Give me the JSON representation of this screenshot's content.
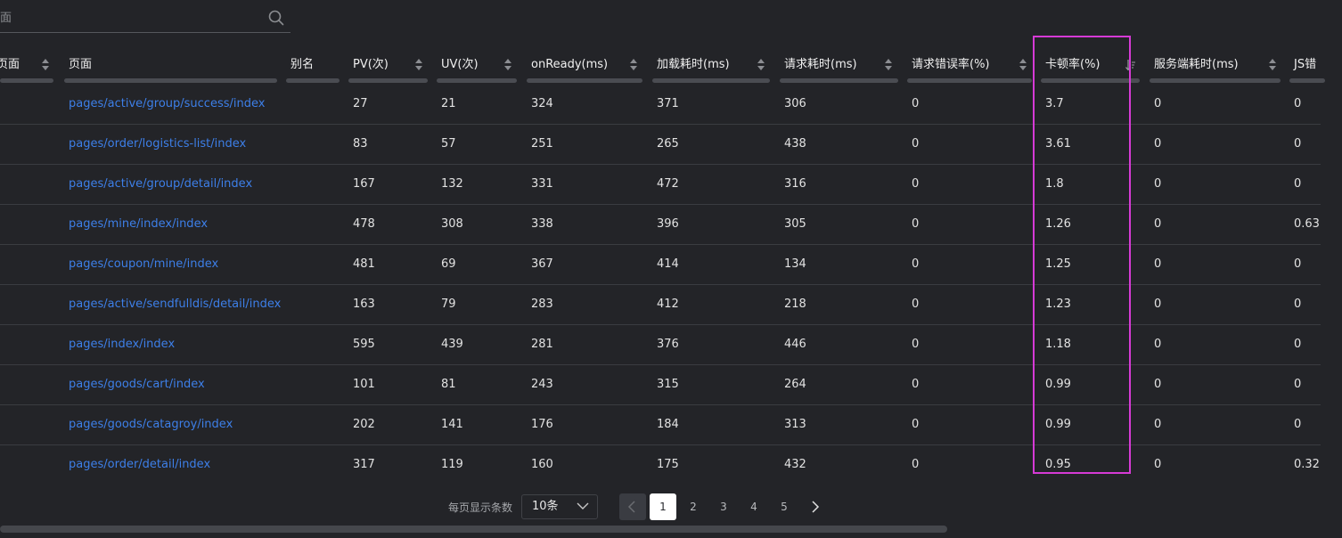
{
  "search": {
    "placeholder": "面",
    "icon": "search-icon"
  },
  "table": {
    "headers": [
      {
        "label": "页面"
      },
      {
        "label": "页面"
      },
      {
        "label": "别名"
      },
      {
        "label": "PV(次)"
      },
      {
        "label": "UV(次)"
      },
      {
        "label": "onReady(ms)"
      },
      {
        "label": "加载耗时(ms)"
      },
      {
        "label": "请求耗时(ms)"
      },
      {
        "label": "请求错误率(%)"
      },
      {
        "label": "卡顿率(%)"
      },
      {
        "label": "服务端耗时(ms)"
      },
      {
        "label": "JS错"
      }
    ],
    "sorted_column": "卡顿率(%)",
    "sorted_direction": "descending",
    "rows": [
      {
        "page": "pages/active/group/success/index",
        "pv": "27",
        "uv": "21",
        "onready": "324",
        "load": "371",
        "request": "306",
        "req_err": "0",
        "jank": "3.7",
        "server": "0",
        "js": "0"
      },
      {
        "page": "pages/order/logistics-list/index",
        "pv": "83",
        "uv": "57",
        "onready": "251",
        "load": "265",
        "request": "438",
        "req_err": "0",
        "jank": "3.61",
        "server": "0",
        "js": "0"
      },
      {
        "page": "pages/active/group/detail/index",
        "pv": "167",
        "uv": "132",
        "onready": "331",
        "load": "472",
        "request": "316",
        "req_err": "0",
        "jank": "1.8",
        "server": "0",
        "js": "0"
      },
      {
        "page": "pages/mine/index/index",
        "pv": "478",
        "uv": "308",
        "onready": "338",
        "load": "396",
        "request": "305",
        "req_err": "0",
        "jank": "1.26",
        "server": "0",
        "js": "0.63"
      },
      {
        "page": "pages/coupon/mine/index",
        "pv": "481",
        "uv": "69",
        "onready": "367",
        "load": "414",
        "request": "134",
        "req_err": "0",
        "jank": "1.25",
        "server": "0",
        "js": "0"
      },
      {
        "page": "pages/active/sendfulldis/detail/index",
        "pv": "163",
        "uv": "79",
        "onready": "283",
        "load": "412",
        "request": "218",
        "req_err": "0",
        "jank": "1.23",
        "server": "0",
        "js": "0"
      },
      {
        "page": "pages/index/index",
        "pv": "595",
        "uv": "439",
        "onready": "281",
        "load": "376",
        "request": "446",
        "req_err": "0",
        "jank": "1.18",
        "server": "0",
        "js": "0"
      },
      {
        "page": "pages/goods/cart/index",
        "pv": "101",
        "uv": "81",
        "onready": "243",
        "load": "315",
        "request": "264",
        "req_err": "0",
        "jank": "0.99",
        "server": "0",
        "js": "0"
      },
      {
        "page": "pages/goods/catagroy/index",
        "pv": "202",
        "uv": "141",
        "onready": "176",
        "load": "184",
        "request": "313",
        "req_err": "0",
        "jank": "0.99",
        "server": "0",
        "js": "0"
      },
      {
        "page": "pages/order/detail/index",
        "pv": "317",
        "uv": "119",
        "onready": "160",
        "load": "175",
        "request": "432",
        "req_err": "0",
        "jank": "0.95",
        "server": "0",
        "js": "0.32"
      }
    ]
  },
  "pagination": {
    "page_size_label": "每页显示条数",
    "page_size_value": "10条",
    "pages": [
      "1",
      "2",
      "3",
      "4",
      "5"
    ],
    "current_page": "1"
  },
  "colors": {
    "background": "#232428",
    "link": "#3d7fe8",
    "highlight_box": "#d63ad6"
  }
}
